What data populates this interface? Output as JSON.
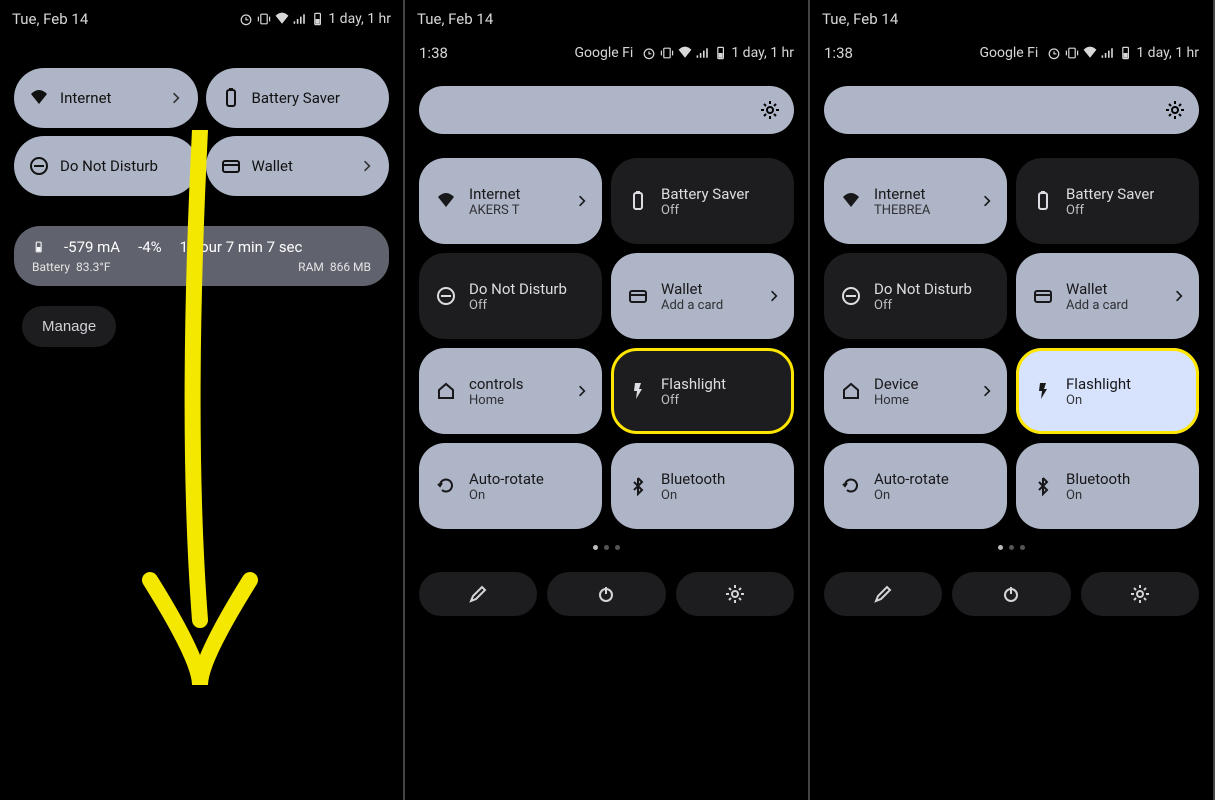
{
  "panel1": {
    "status": {
      "date": "Tue, Feb 14",
      "right": "1 day, 1 hr"
    },
    "tiles": {
      "internet": "Internet",
      "battery_saver": "Battery Saver",
      "dnd": "Do Not Disturb",
      "wallet": "Wallet"
    },
    "notif": {
      "current": "-579 mA",
      "pct": "-4%",
      "time": "1 hour 7 min 7 sec",
      "battery_label": "Battery",
      "battery_val": "83.3°F",
      "ram_label": "RAM",
      "ram_val": "866 MB"
    },
    "manage": "Manage"
  },
  "panel2": {
    "status": {
      "date": "Tue, Feb 14"
    },
    "carrier": {
      "time": "1:38",
      "name": "Google Fi",
      "right": "1 day, 1 hr"
    },
    "tiles": [
      {
        "title": "Internet",
        "sub": "AKERS   T",
        "chev": true,
        "dark": false
      },
      {
        "title": "Battery Saver",
        "sub": "Off",
        "chev": false,
        "dark": true
      },
      {
        "title": "Do Not Disturb",
        "sub": "Off",
        "chev": false,
        "dark": true
      },
      {
        "title": "Wallet",
        "sub": "Add a card",
        "chev": true,
        "dark": false
      },
      {
        "title": "controls",
        "sub": "Home",
        "chev": true,
        "dark": false
      },
      {
        "title": "Flashlight",
        "sub": "Off",
        "chev": false,
        "dark": true,
        "highlight": true
      },
      {
        "title": "Auto-rotate",
        "sub": "On",
        "chev": false,
        "dark": false
      },
      {
        "title": "Bluetooth",
        "sub": "On",
        "chev": false,
        "dark": false
      }
    ]
  },
  "panel3": {
    "status": {
      "date": "Tue, Feb 14"
    },
    "carrier": {
      "time": "1:38",
      "name": "Google Fi",
      "right": "1 day, 1 hr"
    },
    "tiles": [
      {
        "title": "Internet",
        "sub": "THEBREA",
        "chev": true,
        "dark": false
      },
      {
        "title": "Battery Saver",
        "sub": "Off",
        "chev": false,
        "dark": true
      },
      {
        "title": "Do Not Disturb",
        "sub": "Off",
        "chev": false,
        "dark": true
      },
      {
        "title": "Wallet",
        "sub": "Add a card",
        "chev": true,
        "dark": false
      },
      {
        "title": "Device",
        "sub": "Home",
        "chev": true,
        "dark": false
      },
      {
        "title": "Flashlight",
        "sub": "On",
        "chev": false,
        "dark": false,
        "highlight": true,
        "activeLight": true
      },
      {
        "title": "Auto-rotate",
        "sub": "On",
        "chev": false,
        "dark": false
      },
      {
        "title": "Bluetooth",
        "sub": "On",
        "chev": false,
        "dark": false
      }
    ]
  },
  "icons": {
    "wifi": "wifi",
    "battery": "battery",
    "dnd": "dnd",
    "wallet": "wallet",
    "home": "home",
    "flashlight": "flashlight",
    "rotate": "rotate",
    "bluetooth": "bluetooth",
    "gear": "gear",
    "pencil": "pencil",
    "power": "power",
    "chevron": "chevron"
  }
}
